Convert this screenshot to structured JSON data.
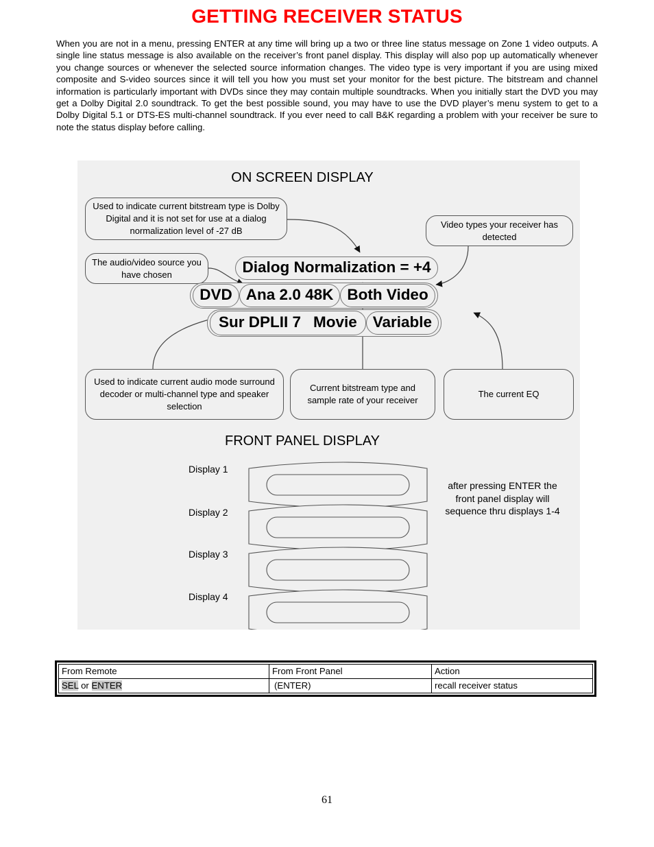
{
  "page": {
    "title": "GETTING RECEIVER STATUS",
    "title_color": "#fe0000",
    "number": "61",
    "body": "When you are not in a menu, pressing ENTER at any time will bring up a two or three line status message on Zone 1 video outputs. A single line status message is also available on the receiver’s front panel display. This display will also pop up automatically whenever you change sources or whenever the selected source information changes. The video type is very important if you are using mixed composite and S-video sources since it will tell you how you must set your monitor for the best picture. The bitstream and channel information is particularly important with DVDs since they may contain multiple soundtracks. When you initially start the DVD you may get a Dolby Digital 2.0 soundtrack. To get the best possible sound, you may have to use the DVD player’s menu system to get to a Dolby Digital 5.1 or DTS-ES multi-channel soundtrack. If you ever need to call B&K regarding a problem with your receiver be sure to note the status display before calling."
  },
  "diagram": {
    "background_color": "#f0f0f0",
    "osd_title": "ON SCREEN DISPLAY",
    "fpd_title": "FRONT PANEL DISPLAY",
    "callouts": {
      "bitstream": "Used to indicate current bitstream type is Dolby Digital and it is not set for use at a dialog normalization level of -27 dB",
      "source": "The audio/video source you have chosen",
      "video_types": "Video types your receiver has detected",
      "audio_mode": "Used to indicate current audio mode surround decoder or multi-channel type and speaker selection",
      "bitstream_rate": "Current bitstream type and sample rate of your receiver",
      "eq": "The current EQ"
    },
    "osd_status": {
      "line1": "Dialog Normalization = +4",
      "line2_source": "DVD",
      "line2_bitstream": "Ana 2.0 48K",
      "line2_video": "Both Video",
      "line3_mode": "Sur  DPLII  7",
      "line3_preset": "Movie",
      "line3_eq": "Variable"
    },
    "front_panel": {
      "labels": [
        "Display 1",
        "Display 2",
        "Display 3",
        "Display 4"
      ],
      "note": "after pressing ENTER the front panel display will sequence thru displays 1-4"
    }
  },
  "command_table": {
    "headers": [
      "From Remote",
      "From Front Panel",
      "Action"
    ],
    "rows": [
      {
        "remote_key_1": "SEL",
        "remote_conjunction": " or ",
        "remote_key_2": "ENTER",
        "front_panel": "(ENTER)",
        "action": "recall receiver status"
      }
    ],
    "highlight_color": "#c8c8c8"
  }
}
